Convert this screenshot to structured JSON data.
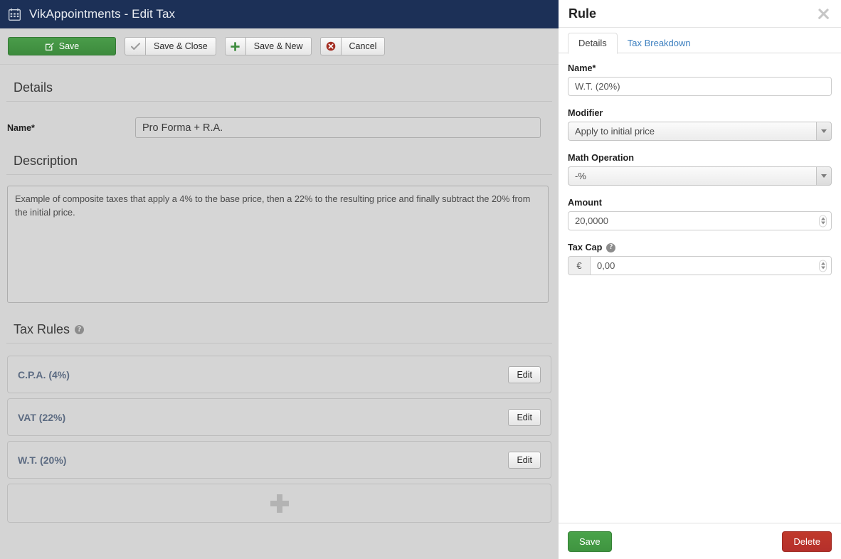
{
  "window": {
    "icon": "calendar-icon",
    "title": "VikAppointments - Edit Tax"
  },
  "toolbar": {
    "save_label": "Save",
    "save_icon": "pencil-square-icon",
    "save_close_label": "Save & Close",
    "save_close_icon": "check-icon",
    "save_new_label": "Save & New",
    "save_new_icon": "plus-icon",
    "cancel_label": "Cancel",
    "cancel_icon": "times-circle-icon"
  },
  "details": {
    "section_title": "Details",
    "name_label": "Name*",
    "name_value": "Pro Forma + R.A."
  },
  "description": {
    "section_title": "Description",
    "text": "Example of composite taxes that apply a 4% to the base price, then a 22% to the resulting price and finally subtract the 20% from the initial price."
  },
  "tax_rules": {
    "section_title": "Tax Rules",
    "help_icon": "question-mark-icon",
    "edit_label": "Edit",
    "add_icon": "plus-icon",
    "rows": [
      {
        "label": "C.P.A. (4%)"
      },
      {
        "label": "VAT (22%)"
      },
      {
        "label": "W.T. (20%)"
      }
    ]
  },
  "rule_panel": {
    "title": "Rule",
    "close_icon": "close-icon",
    "tabs": [
      {
        "label": "Details",
        "active": true
      },
      {
        "label": "Tax Breakdown",
        "active": false
      }
    ],
    "name_label": "Name*",
    "name_value": "W.T. (20%)",
    "modifier_label": "Modifier",
    "modifier_value": "Apply to initial price",
    "modifier_arrow_icon": "chevron-down-icon",
    "math_operation_label": "Math Operation",
    "math_operation_value": "-%",
    "math_operation_arrow_icon": "chevron-down-icon",
    "amount_label": "Amount",
    "amount_value": "20,0000",
    "amount_spinner_icon": "spinner-icon",
    "tax_cap_label": "Tax Cap",
    "tax_cap_help_icon": "question-mark-icon",
    "tax_cap_currency": "€",
    "tax_cap_value": "0,00",
    "tax_cap_spinner_icon": "spinner-icon",
    "save_label": "Save",
    "delete_label": "Delete"
  },
  "colors": {
    "titlebar_bg": "#1c3057",
    "page_bg": "#d4d4d4",
    "save_green": "#3d8b3d",
    "delete_red": "#b5302b",
    "link_blue": "#3c7fbf",
    "rule_label": "#5c6b82"
  }
}
